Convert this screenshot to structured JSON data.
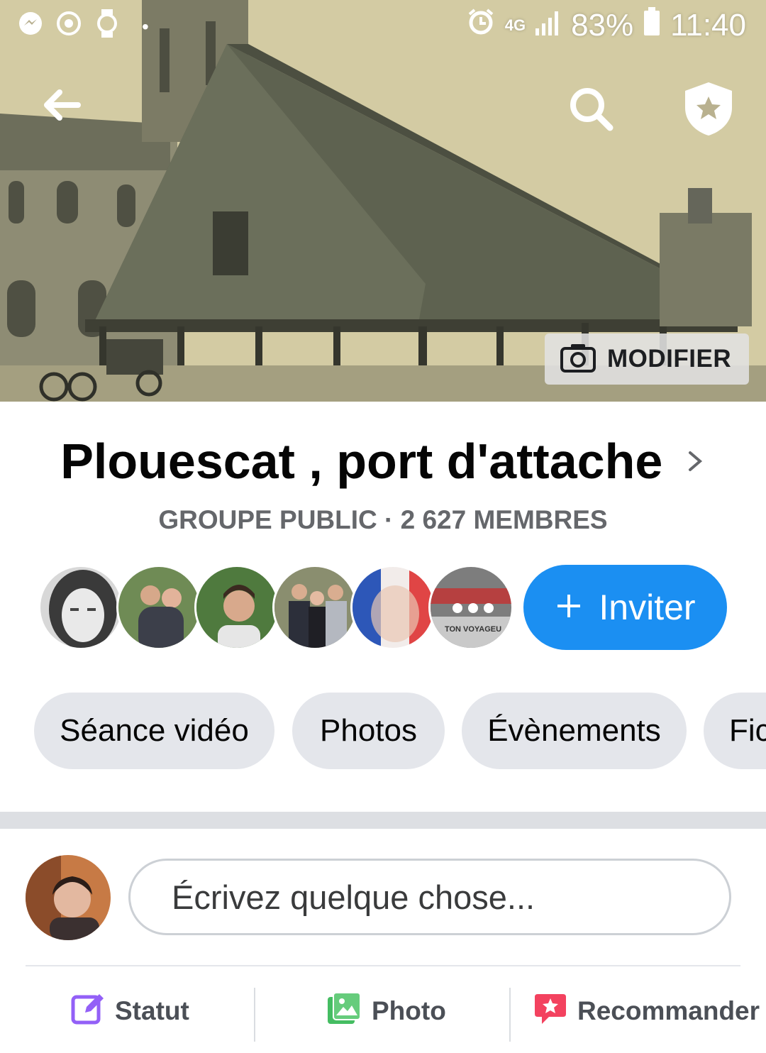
{
  "status_bar": {
    "battery": "83%",
    "time": "11:40",
    "network": "4G",
    "icons": [
      "messenger-icon",
      "sync-icon",
      "watch-icon",
      "alarm-icon",
      "signal-icon",
      "battery-icon"
    ]
  },
  "nav": {
    "back_icon": "arrow-left-icon",
    "search_icon": "search-icon",
    "shield_icon": "admin-shield-icon"
  },
  "cover": {
    "edit_label": "MODIFIER",
    "edit_icon": "camera-icon"
  },
  "group": {
    "title": "Plouescat , port d'attache",
    "meta": "GROUPE PUBLIC · 2 627 MEMBRES"
  },
  "members": {
    "avatars": [
      "member-1",
      "member-2",
      "member-3",
      "member-4",
      "member-5"
    ],
    "more_icon": "more-dots-icon",
    "more_caption": "TON VOYAGEU",
    "invite_label": "Inviter",
    "invite_icon": "plus-icon"
  },
  "tabs": [
    {
      "label": "Séance vidéo"
    },
    {
      "label": "Photos"
    },
    {
      "label": "Évènements"
    },
    {
      "label": "Fic"
    }
  ],
  "composer": {
    "placeholder": "Écrivez quelque chose..."
  },
  "actions": [
    {
      "label": "Statut",
      "icon": "edit-status-icon",
      "color": "#9360f7"
    },
    {
      "label": "Photo",
      "icon": "photo-icon",
      "color": "#45bd62"
    },
    {
      "label": "Recommander",
      "icon": "recommend-icon",
      "color": "#f3425f"
    }
  ],
  "colors": {
    "accent": "#1b8ff2",
    "tab_bg": "#e4e6eb",
    "meta_text": "#65676b"
  }
}
